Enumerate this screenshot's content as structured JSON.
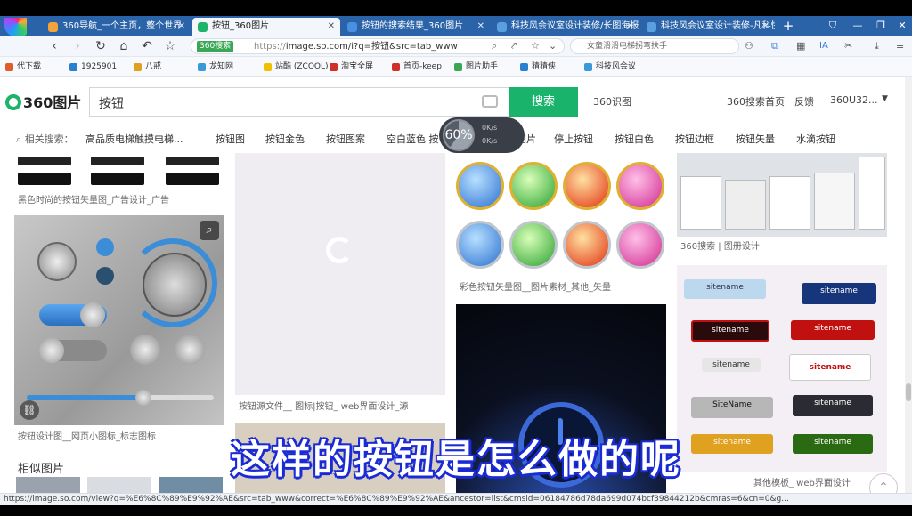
{
  "browser": {
    "tabs": [
      {
        "label": "360导航_一个主页，整个世界",
        "color": "#f2a33a"
      },
      {
        "label": "按钮_360图片",
        "color": "#1db36b"
      },
      {
        "label": "按钮的搜索结果_360图片",
        "color": "#4a90e2"
      },
      {
        "label": "科技风会议室设计装修/长图海报",
        "color": "#5aa0e0"
      },
      {
        "label": "科技风会议室设计装修-凡科快图",
        "color": "#5aa0e0"
      }
    ],
    "new_tab": "+",
    "url_badge": "360搜索",
    "url_secure": "https://",
    "url_text": "image.so.com/i?q=按钮&src=tab_www",
    "omni_search": "女童滑滑电梯拐弯扶手",
    "bookmarks": [
      "代下载",
      "1925901",
      "八戒",
      "龙知网",
      "站酷 (ZCOOL)",
      "淘宝全屏",
      "首页-keep",
      "图片助手",
      "猜猜侠",
      "科技风会议"
    ],
    "bookmark_colors": [
      "#e05c2a",
      "#2a80d0",
      "#e0a020",
      "#3a9ad9",
      "#f0c000",
      "#d0302a",
      "#d0302a",
      "#3aa757",
      "#2a80d0",
      "#3a9ad9"
    ]
  },
  "search": {
    "logo": "360图片",
    "query": "按钮",
    "button": "搜索",
    "shitu": "360识图",
    "links": [
      "360搜索首页",
      "反馈",
      "360U32..."
    ]
  },
  "related": {
    "label": "相关搜索：",
    "items": [
      "高品质电梯触摸电梯...",
      "按钮图",
      "按钮金色",
      "按钮图案",
      "空白蓝色 按",
      "图片",
      "停止按钮",
      "按钮白色",
      "按钮边框",
      "按钮矢量",
      "水滴按钮"
    ]
  },
  "results": {
    "cap1": "黑色时尚的按钮矢量图_广告设计_广告",
    "cap2": "按钮设计图__网页小图标_标志图标",
    "cap3": "按钮源文件__ 图标|按钮_ web界面设计_源",
    "cap4": "彩色按钮矢量图__图片素材_其他_矢量",
    "cap5": "360搜索 | 图册设计",
    "cap6": "其他模板_ web界面设计",
    "similar": "相似图片",
    "sitename_labels": [
      "sitename",
      "sitename",
      "sitename",
      "sitename",
      "sitename",
      "sitename",
      "SiteName",
      "sitename",
      "sitename",
      "sitename"
    ]
  },
  "gauge": {
    "percent": "60%",
    "up": "0K/s",
    "down": "0K/s",
    "fill_fraction": 0.6
  },
  "subtitle": "这样的按钮是怎么做的呢",
  "status_url": "https://image.so.com/view?q=%E6%8C%89%E9%92%AE&src=tab_www&correct=%E6%8C%89%E9%92%AE&ancestor=list&cmsid=06184786d78da699d074bcf39844212b&cmras=6&cn=0&g..."
}
